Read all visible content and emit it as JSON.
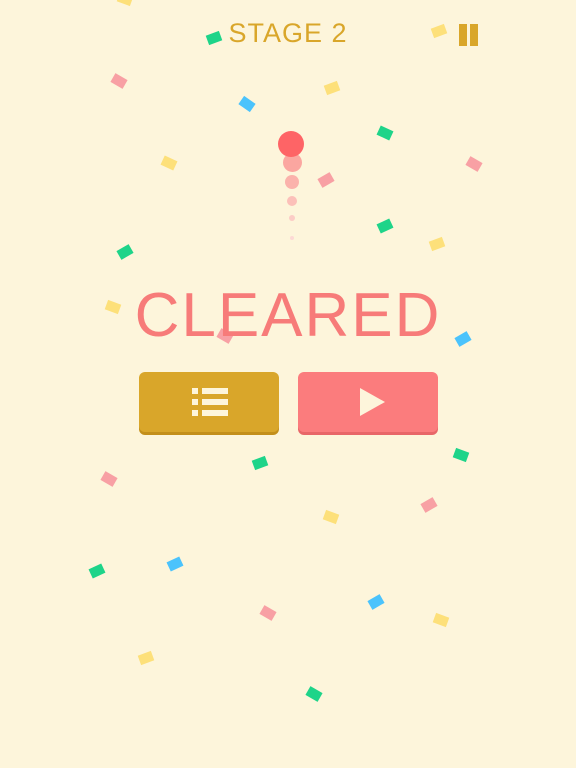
{
  "hud": {
    "stage_label": "STAGE 2"
  },
  "result": {
    "title": "CLEARED"
  },
  "buttons": {
    "menu": "menu",
    "play": "play"
  },
  "colors": {
    "background": "#fdf5db",
    "gold": "#d9a62a",
    "coral": "#f77b79",
    "confetti_green": "#1ed489",
    "confetti_blue": "#4bc3fc",
    "confetti_yellow": "#fde07a",
    "confetti_pink": "#f8a0a4"
  }
}
